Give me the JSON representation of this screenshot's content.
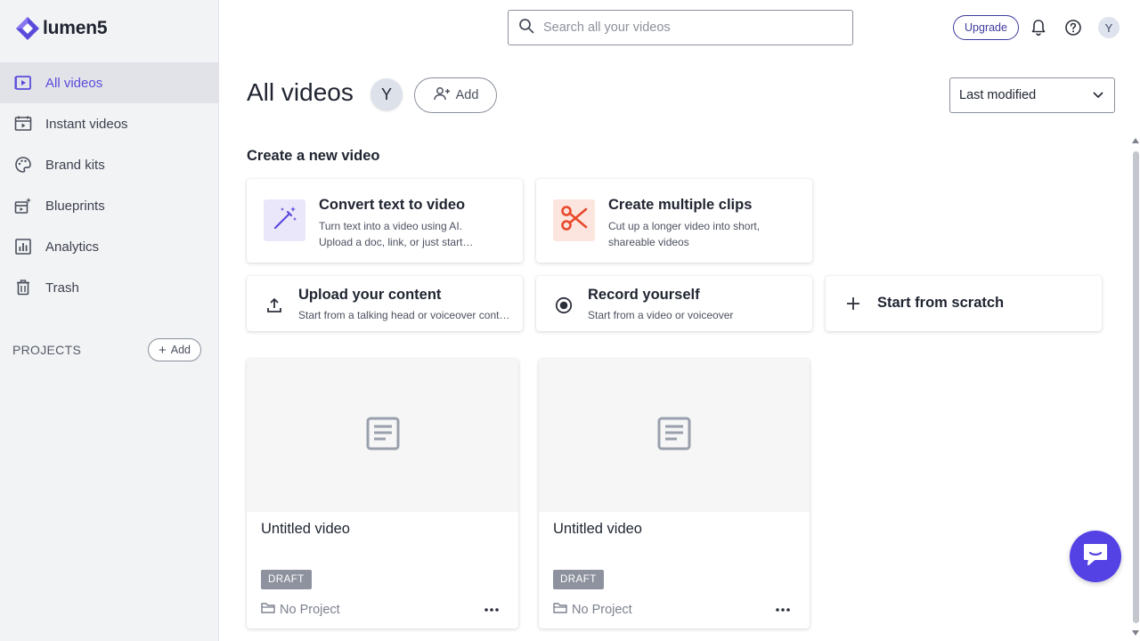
{
  "app": {
    "logo_text": "lumen5",
    "brand_color": "#5b4bdb"
  },
  "sidebar": {
    "items": [
      {
        "label": "All videos",
        "icon": "play-square-icon",
        "active": true
      },
      {
        "label": "Instant videos",
        "icon": "calendar-film-icon"
      },
      {
        "label": "Brand kits",
        "icon": "palette-icon"
      },
      {
        "label": "Blueprints",
        "icon": "sparkle-film-icon"
      },
      {
        "label": "Analytics",
        "icon": "bar-chart-icon"
      },
      {
        "label": "Trash",
        "icon": "trash-icon"
      }
    ],
    "projects_label": "PROJECTS",
    "projects_add_label": "Add"
  },
  "topbar": {
    "search_placeholder": "Search all your videos",
    "upgrade_label": "Upgrade",
    "avatar_initial": "Y"
  },
  "header": {
    "title": "All videos",
    "member_initial": "Y",
    "add_member_label": "Add",
    "sort_value": "Last modified"
  },
  "create": {
    "section_title": "Create a new video",
    "cards": [
      {
        "title": "Convert text to video",
        "desc": "Turn text into a video using AI. Upload a doc, link, or just start…",
        "icon": "magic-wand-icon",
        "tile_color": "#ebe7fb"
      },
      {
        "title": "Create multiple clips",
        "desc": "Cut up a longer video into short, shareable videos",
        "icon": "scissors-icon",
        "tile_color": "#fde5df"
      },
      {
        "title": "Upload your content",
        "desc": "Start from a talking head or voiceover content",
        "icon": "upload-icon"
      },
      {
        "title": "Record yourself",
        "desc": "Start from a video or voiceover",
        "icon": "record-icon"
      },
      {
        "title": "Start from scratch",
        "icon": "plus-icon"
      }
    ]
  },
  "videos": [
    {
      "title": "Untitled video",
      "status": "DRAFT",
      "project": "No Project"
    },
    {
      "title": "Untitled video",
      "status": "DRAFT",
      "project": "No Project"
    }
  ]
}
